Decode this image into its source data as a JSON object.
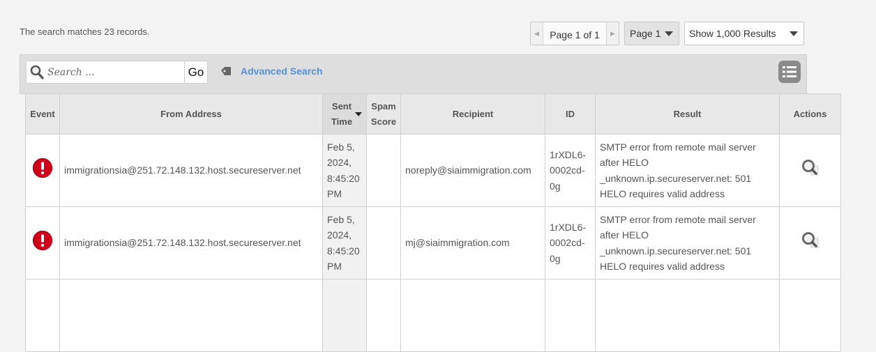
{
  "summary": "The search matches 23 records.",
  "pager": {
    "label": "Page 1 of 1",
    "page_select": "Page 1",
    "results_select": "Show 1,000 Results"
  },
  "search": {
    "placeholder": "Search ...",
    "go_label": "Go",
    "advanced_label": "Advanced Search"
  },
  "table": {
    "headers": {
      "event": "Event",
      "from": "From Address",
      "sent": "Sent Time",
      "spam": "Spam Score",
      "recipient": "Recipient",
      "id": "ID",
      "result": "Result",
      "actions": "Actions"
    },
    "rows": [
      {
        "event_icon": "error-icon",
        "from": "immigrationsia@251.72.148.132.host.secureserver.net",
        "sent": "Feb 5, 2024, 8:45:20 PM",
        "spam": "",
        "recipient": "noreply@siaimmigration.com",
        "id": "1rXDL6-0002cd-0g",
        "result": "SMTP error from remote mail server after HELO _unknown.ip.secureserver.net: 501 HELO requires valid address",
        "action_icon": "magnifier-icon"
      },
      {
        "event_icon": "error-icon",
        "from": "immigrationsia@251.72.148.132.host.secureserver.net",
        "sent": "Feb 5, 2024, 8:45:20 PM",
        "spam": "",
        "recipient": "mj@siaimmigration.com",
        "id": "1rXDL6-0002cd-0g",
        "result": "SMTP error from remote mail server after HELO _unknown.ip.secureserver.net: 501 HELO requires valid address",
        "action_icon": "magnifier-icon"
      }
    ]
  },
  "colors": {
    "error_red": "#d0021b",
    "link_blue": "#5a8fd8"
  }
}
